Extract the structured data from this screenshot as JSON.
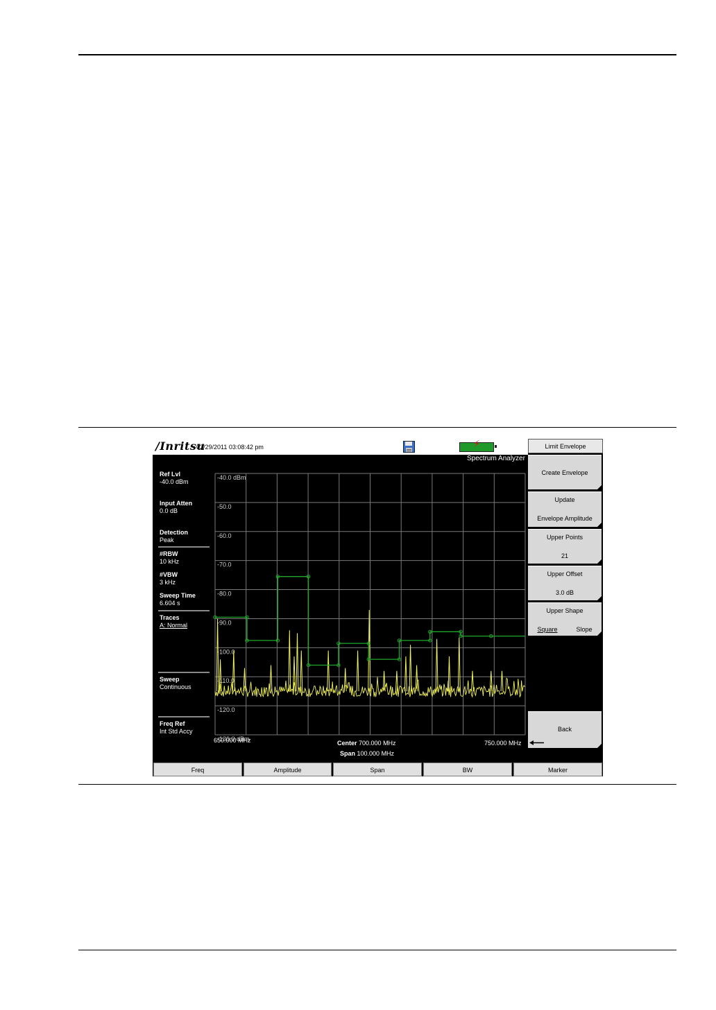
{
  "screen": {
    "brand": "/Inritsu",
    "datetime": "03/29/2011 03:08:42 pm",
    "mode": "Spectrum Analyzer",
    "icons": {
      "save": "save-disk-icon",
      "battery": "battery-icon",
      "charging": "lightning-bolt-icon"
    }
  },
  "left_panel": {
    "ref_lvl": {
      "label": "Ref Lvl",
      "value": "-40.0 dBm"
    },
    "input_atten": {
      "label": "Input Atten",
      "value": "0.0 dB"
    },
    "detection": {
      "label": "Detection",
      "value": "Peak"
    },
    "rbw": {
      "label": "#RBW",
      "value": "10 kHz"
    },
    "vbw": {
      "label": "#VBW",
      "value": "3 kHz"
    },
    "sweep_time": {
      "label": "Sweep Time",
      "value": "6.604 s"
    },
    "traces": {
      "label": "Traces",
      "value": "A: Normal"
    },
    "sweep": {
      "label": "Sweep",
      "value": "Continuous"
    },
    "freq_ref": {
      "label": "Freq Ref",
      "value": "Int Std Accy"
    }
  },
  "x_axis": {
    "start_label": "650.000 MHz",
    "stop_label": "750.000 MHz",
    "center_label": "Center",
    "center_value": "700.000 MHz",
    "span_label": "Span",
    "span_value": "100.000 MHz"
  },
  "softkeys": {
    "title": "Limit Envelope",
    "create_envelope": "Create Envelope",
    "update_line1": "Update",
    "update_line2": "Envelope Amplitude",
    "upper_points_label": "Upper Points",
    "upper_points_value": "21",
    "upper_offset_label": "Upper Offset",
    "upper_offset_value": "3.0 dB",
    "upper_shape_label": "Upper Shape",
    "shape_square": "Square",
    "shape_slope": "Slope",
    "back": "Back",
    "back_icon": "back-arrow-icon"
  },
  "bottom_keys": [
    "Freq",
    "Amplitude",
    "Span",
    "BW",
    "Marker"
  ],
  "colors": {
    "trace": "#f2f25a",
    "limit": "#1fa82b",
    "grid": "#7a7a7a"
  },
  "chart_data": {
    "type": "line",
    "x_range_mhz": [
      650,
      750
    ],
    "ylim": [
      -130,
      -40
    ],
    "y_unit": "dBm",
    "ytick_labels": [
      "-40.0 dBm",
      "-50.0",
      "-60.0",
      "-70.0",
      "-80.0",
      "-90.0",
      "-100.0",
      "-110.0",
      "-120.0",
      "-130.0 dBm"
    ],
    "grid": true,
    "series": [
      {
        "role": "limit-envelope",
        "points": [
          [
            650,
            -89.5
          ],
          [
            660.3,
            -89.5
          ],
          [
            660.3,
            -97.5
          ],
          [
            670.2,
            -97.5
          ],
          [
            670.2,
            -75.5
          ],
          [
            680.1,
            -75.5
          ],
          [
            680.1,
            -106
          ],
          [
            689.8,
            -106
          ],
          [
            689.8,
            -98.5
          ],
          [
            699.5,
            -98.5
          ],
          [
            699.5,
            -104
          ],
          [
            709.4,
            -104
          ],
          [
            709.4,
            -97.5
          ],
          [
            719.3,
            -97.5
          ],
          [
            719.3,
            -94.5
          ],
          [
            729.2,
            -94.5
          ],
          [
            729.2,
            -96
          ],
          [
            739.0,
            -96
          ],
          [
            750,
            -96
          ]
        ]
      },
      {
        "role": "trace-peaks",
        "peaks": [
          [
            650.8,
            -90
          ],
          [
            651.7,
            -104
          ],
          [
            656,
            -101
          ],
          [
            659.5,
            -107
          ],
          [
            668,
            -106
          ],
          [
            674,
            -94
          ],
          [
            675.5,
            -103
          ],
          [
            676.5,
            -95
          ],
          [
            677.8,
            -101
          ],
          [
            686.5,
            -101
          ],
          [
            692,
            -107
          ],
          [
            696,
            -101
          ],
          [
            699.7,
            -87
          ],
          [
            704.5,
            -108
          ],
          [
            708.6,
            -108
          ],
          [
            711.5,
            -103
          ],
          [
            713,
            -99
          ],
          [
            715,
            -106
          ],
          [
            721.5,
            -97
          ],
          [
            725.5,
            -103
          ],
          [
            728.7,
            -96.5
          ],
          [
            733,
            -108
          ],
          [
            739,
            -108
          ],
          [
            742.5,
            -108
          ]
        ],
        "noise_floor": -115
      }
    ]
  }
}
